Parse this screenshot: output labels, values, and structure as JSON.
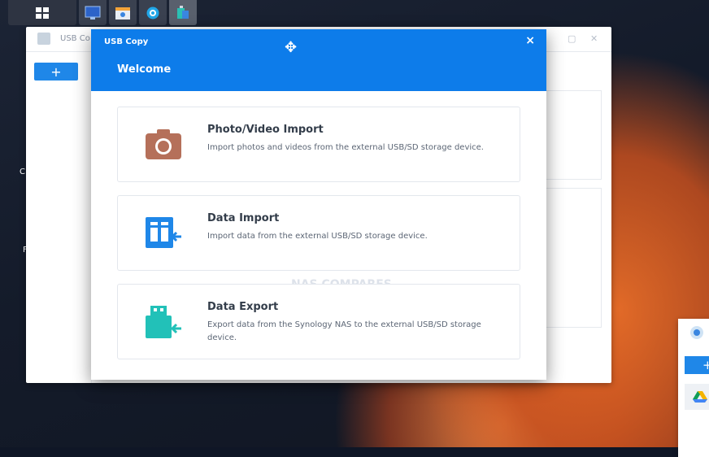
{
  "taskbar": {
    "buttons": [
      {
        "icon": "main-menu-icon"
      },
      {
        "icon": "control-panel-icon"
      },
      {
        "icon": "package-center-icon"
      },
      {
        "icon": "search-app-icon"
      },
      {
        "icon": "usb-copy-taskbar-icon"
      }
    ]
  },
  "background_window": {
    "title": "USB Co",
    "add_label": "+",
    "controls": [
      "–",
      "▢",
      "✕"
    ]
  },
  "modal": {
    "title": "USB Copy",
    "close_label": "×",
    "heading": "Welcome",
    "options": [
      {
        "title": "Photo/Video Import",
        "description": "Import photos and videos from the external USB/SD storage device.",
        "icon": "camera-icon",
        "color": "#b5705a"
      },
      {
        "title": "Data Import",
        "description": "Import data from the external USB/SD storage device.",
        "icon": "data-import-icon",
        "color": "#1f87e8"
      },
      {
        "title": "Data Export",
        "description": "Export data from the Synology NAS to the external USB/SD storage device.",
        "icon": "data-export-icon",
        "color": "#22c1b8"
      }
    ],
    "watermark": "NAS COMPARES"
  },
  "side_window": {
    "add_label": "+"
  },
  "desktop_labels": [
    "C",
    "F"
  ],
  "colors": {
    "accent": "#0d7cea",
    "brand_blue": "#1f87e8"
  }
}
